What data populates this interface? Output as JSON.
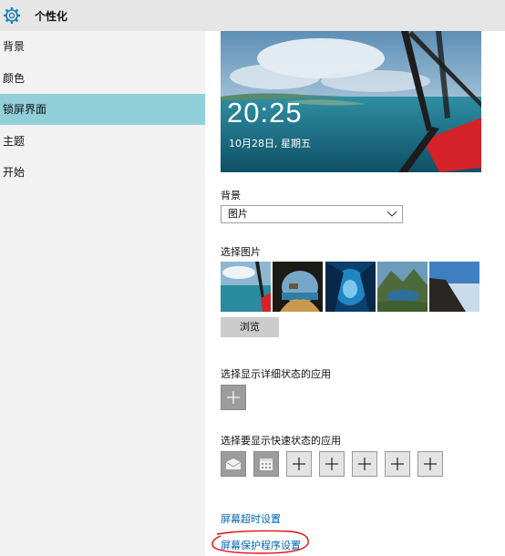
{
  "window": {
    "title": "个性化"
  },
  "sidebar": {
    "items": [
      {
        "label": "背景"
      },
      {
        "label": "颜色"
      },
      {
        "label": "锁屏界面"
      },
      {
        "label": "主题"
      },
      {
        "label": "开始"
      }
    ],
    "active_index": 2
  },
  "preview": {
    "time": "20:25",
    "date": "10月28日, 星期五"
  },
  "background": {
    "label": "背景",
    "selected": "图片"
  },
  "choose_picture": {
    "label": "选择图片",
    "browse_label": "浏览"
  },
  "detailed_status": {
    "label": "选择显示详细状态的应用"
  },
  "quick_status": {
    "label": "选择要显示快速状态的应用"
  },
  "links": {
    "screen_timeout": "屏幕超时设置",
    "screen_saver": "屏幕保护程序设置"
  },
  "colors": {
    "accent": "#91cfd9",
    "link": "#0067b8",
    "annotation": "#e01010"
  }
}
